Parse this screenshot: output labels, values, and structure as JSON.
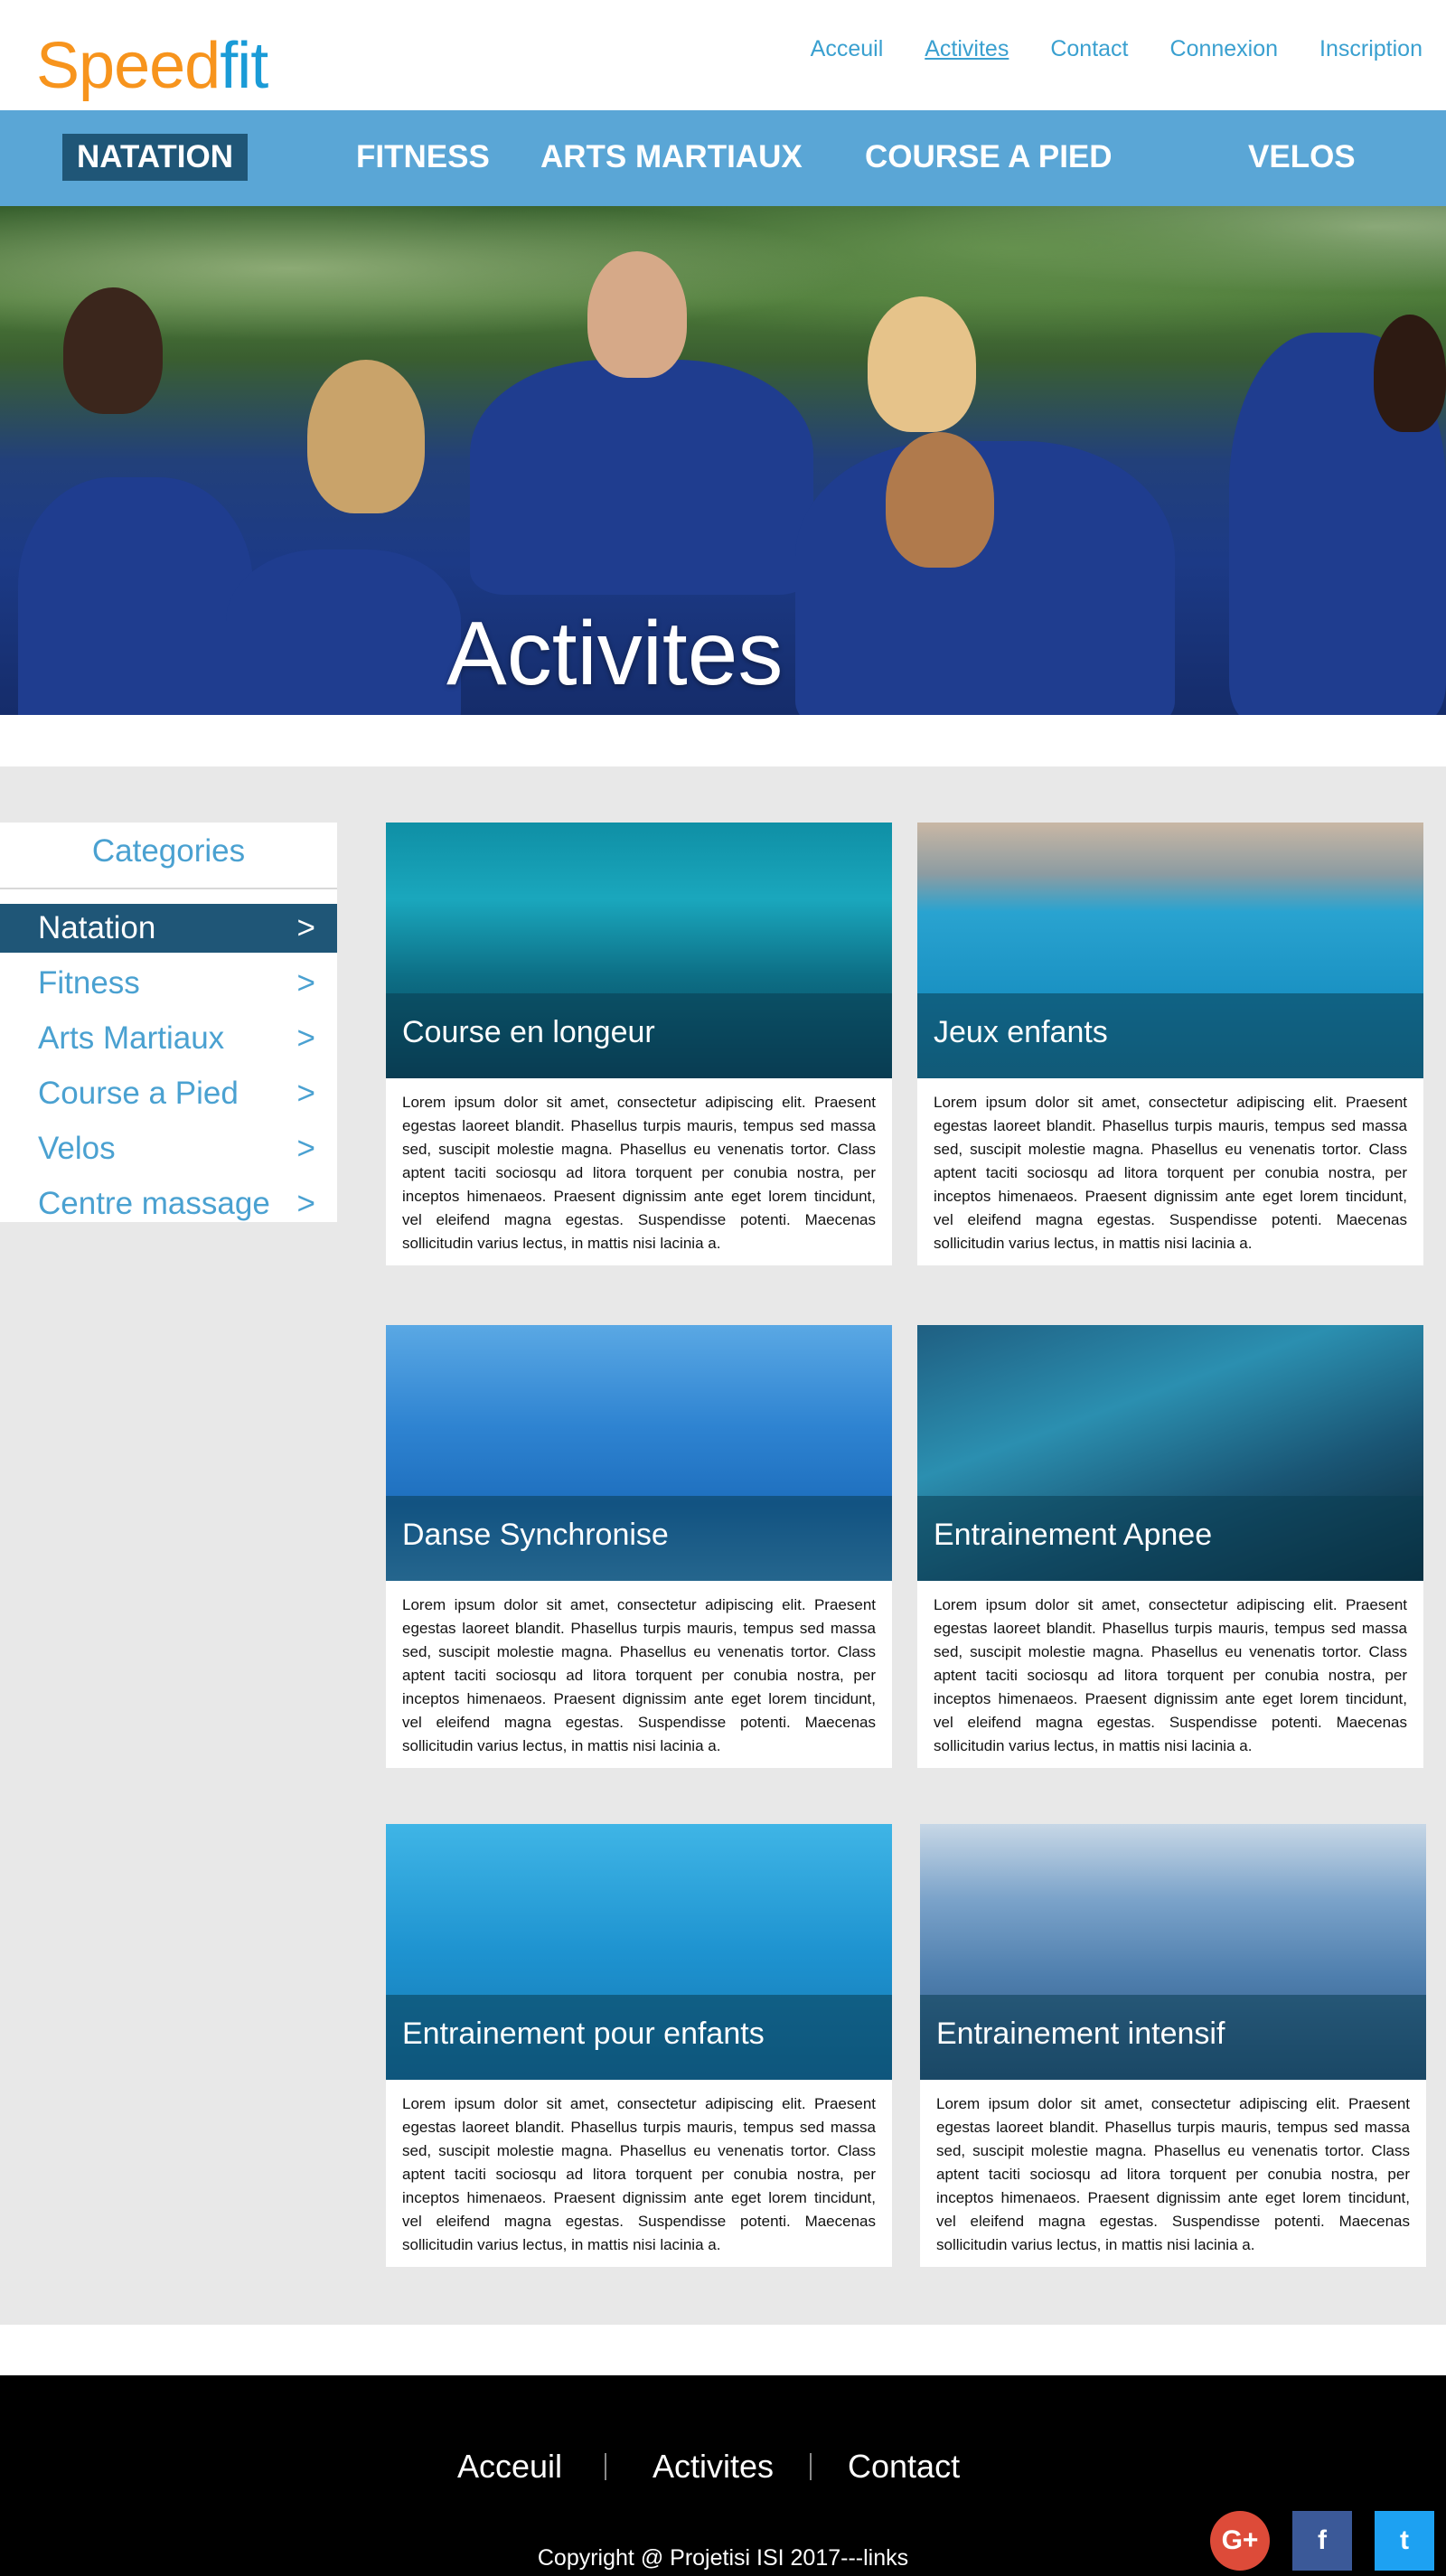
{
  "logo": {
    "speed": "Speed",
    "fit": "fit"
  },
  "top_nav": [
    "Acceuil",
    "Activites",
    "Contact",
    "Connexion",
    "Inscription"
  ],
  "main_nav": [
    "NATATION",
    "FITNESS",
    "ARTS MARTIAUX",
    "COURSE A PIED",
    "VELOS"
  ],
  "hero": {
    "title": "Activites"
  },
  "sidebar": {
    "title": "Categories",
    "items": [
      {
        "label": "Natation",
        "arrow": ">"
      },
      {
        "label": "Fitness",
        "arrow": ">"
      },
      {
        "label": "Arts Martiaux",
        "arrow": ">"
      },
      {
        "label": "Course a Pied",
        "arrow": ">"
      },
      {
        "label": "Velos",
        "arrow": ">"
      },
      {
        "label": "Centre massage",
        "arrow": ">"
      }
    ]
  },
  "cards": [
    {
      "title": "Course en longeur",
      "text": "Lorem ipsum dolor sit amet, consectetur adipiscing elit. Praesent egestas laoreet blandit. Phasellus turpis mauris, tempus sed massa sed, suscipit molestie magna. Phasellus eu venenatis tortor. Class aptent taciti sociosqu ad litora torquent per conubia nostra, per inceptos himenaeos. Praesent dignissim ante eget lorem tincidunt, vel eleifend magna egestas. Suspendisse potenti. Maecenas sollicitudin varius lectus, in mattis nisi lacinia a."
    },
    {
      "title": "Jeux enfants",
      "text": "Lorem ipsum dolor sit amet, consectetur adipiscing elit. Praesent egestas laoreet blandit. Phasellus turpis mauris, tempus sed massa sed, suscipit molestie magna. Phasellus eu venenatis tortor. Class aptent taciti sociosqu ad litora torquent per conubia nostra, per inceptos himenaeos. Praesent dignissim ante eget lorem tincidunt, vel eleifend magna egestas. Suspendisse potenti. Maecenas sollicitudin varius lectus, in mattis nisi lacinia a."
    },
    {
      "title": "Danse Synchronise",
      "text": "Lorem ipsum dolor sit amet, consectetur adipiscing elit. Praesent egestas laoreet blandit. Phasellus turpis mauris, tempus sed massa sed, suscipit molestie magna. Phasellus eu venenatis tortor. Class aptent taciti sociosqu ad litora torquent per conubia nostra, per inceptos himenaeos. Praesent dignissim ante eget lorem tincidunt, vel eleifend magna egestas. Suspendisse potenti. Maecenas sollicitudin varius lectus, in mattis nisi lacinia a."
    },
    {
      "title": "Entrainement Apnee",
      "text": "Lorem ipsum dolor sit amet, consectetur adipiscing elit. Praesent egestas laoreet blandit. Phasellus turpis mauris, tempus sed massa sed, suscipit molestie magna. Phasellus eu venenatis tortor. Class aptent taciti sociosqu ad litora torquent per conubia nostra, per inceptos himenaeos. Praesent dignissim ante eget lorem tincidunt, vel eleifend magna egestas. Suspendisse potenti. Maecenas sollicitudin varius lectus, in mattis nisi lacinia a."
    },
    {
      "title": "Entrainement pour enfants",
      "text": "Lorem ipsum dolor sit amet, consectetur adipiscing elit. Praesent egestas laoreet blandit. Phasellus turpis mauris, tempus sed massa sed, suscipit molestie magna. Phasellus eu venenatis tortor. Class aptent taciti sociosqu ad litora torquent per conubia nostra, per inceptos himenaeos. Praesent dignissim ante eget lorem tincidunt, vel eleifend magna egestas. Suspendisse potenti. Maecenas sollicitudin varius lectus, in mattis nisi lacinia a."
    },
    {
      "title": "Entrainement intensif",
      "text": "Lorem ipsum dolor sit amet, consectetur adipiscing elit. Praesent egestas laoreet blandit. Phasellus turpis mauris, tempus sed massa sed, suscipit molestie magna. Phasellus eu venenatis tortor. Class aptent taciti sociosqu ad litora torquent per conubia nostra, per inceptos himenaeos. Praesent dignissim ante eget lorem tincidunt, vel eleifend magna egestas. Suspendisse potenti. Maecenas sollicitudin varius lectus, in mattis nisi lacinia a."
    }
  ],
  "footer": {
    "nav": [
      "Acceuil",
      "Activites",
      "Contact"
    ],
    "copyright": "Copyright @ Projetisi ISI 2017---links",
    "social": [
      {
        "icon": "google-plus-icon",
        "glyph": "G+"
      },
      {
        "icon": "facebook-icon",
        "glyph": "f"
      },
      {
        "icon": "twitter-icon",
        "glyph": "t"
      }
    ]
  },
  "colors": {
    "nav_blue": "#5aa6d6",
    "active_dark": "#1f5677",
    "logo_orange": "#f7941d",
    "logo_blue": "#1a9bd7",
    "link_blue": "#3aa0d0"
  }
}
